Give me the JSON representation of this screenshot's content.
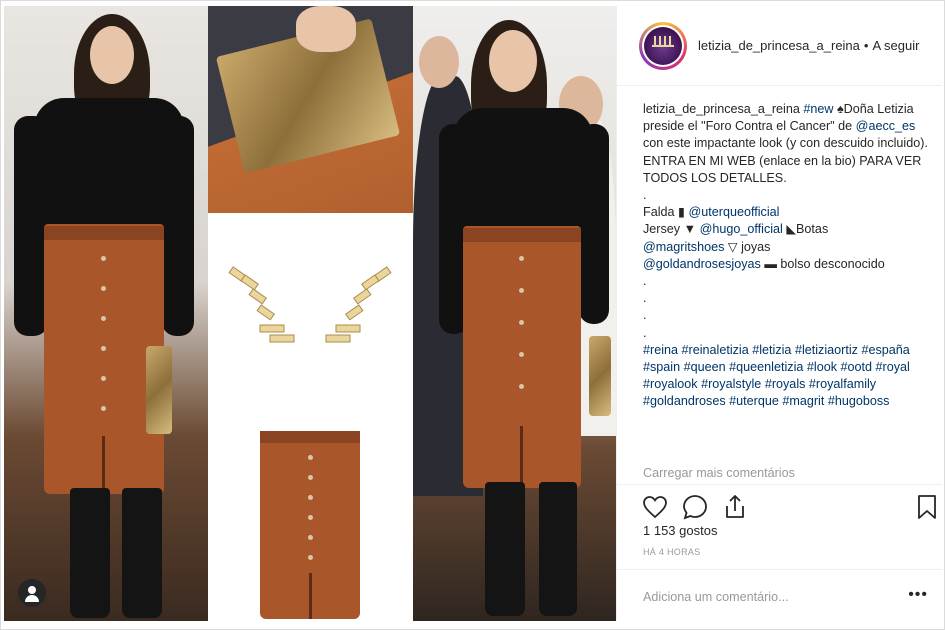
{
  "post": {
    "username": "letizia_de_princesa_a_reina",
    "separator": "•",
    "follow_label": "A seguir",
    "caption_user": "letizia_de_princesa_a_reina",
    "caption_hashtag_new": "#new",
    "caption_line1": " ♠Doña Letizia preside el \"Foro Contra el Cancer\" de ",
    "caption_mention_aecc": "@aecc_es",
    "caption_line2": " con este impactante look (y con descuido incluido). ENTRA EN MI WEB (enlace en la bio) PARA VER TODOS LOS DETALLES.",
    "dot": ".",
    "falda_label": "Falda",
    "falda_mention": "@uterqueofficial",
    "jersey_label": "Jersey",
    "jersey_mention": "@hugo_official",
    "botas_label": "Botas",
    "botas_mention": "@magritshoes",
    "joyas_label": "joyas",
    "joyas_mention": "@goldandrosesjoyas",
    "bolso_label": "bolso desconocido",
    "hashtags": [
      "#reina",
      "#reinaletizia",
      "#letizia",
      "#letiziaortiz",
      "#españa",
      "#spain",
      "#queen",
      "#queenletizia",
      "#look",
      "#ootd",
      "#royal",
      "#royalook",
      "#royalstyle",
      "#royals",
      "#royalfamily",
      "#goldandroses",
      "#uterque",
      "#magrit",
      "#hugoboss"
    ],
    "load_more": "Carregar mais comentários",
    "likes_text": "1 153 gostos",
    "time_text": "HÁ 4 HORAS",
    "comment_placeholder": "Adiciona um comentário...",
    "more_options": "•••"
  },
  "icons": {
    "like": "heart-icon",
    "comment": "comment-icon",
    "share": "share-icon",
    "save": "bookmark-icon",
    "user_tag": "user-tag-icon"
  },
  "colors": {
    "link": "#003569",
    "muted": "#999999",
    "text": "#262626"
  }
}
